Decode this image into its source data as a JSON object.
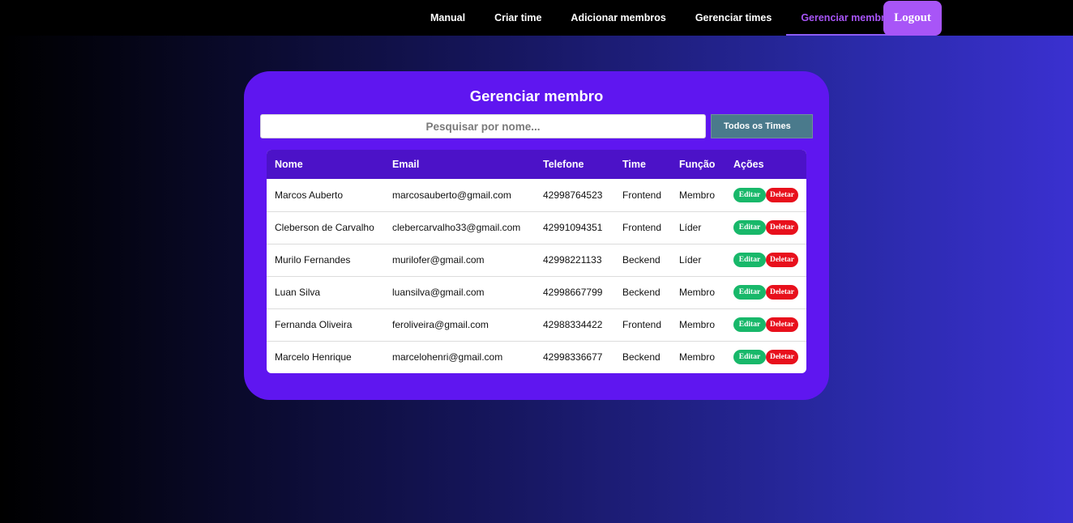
{
  "nav": {
    "items": [
      {
        "label": "Manual",
        "active": false
      },
      {
        "label": "Criar time",
        "active": false
      },
      {
        "label": "Adicionar membros",
        "active": false
      },
      {
        "label": "Gerenciar times",
        "active": false
      },
      {
        "label": "Gerenciar membros",
        "active": true
      }
    ],
    "logout_label": "Logout"
  },
  "card": {
    "title": "Gerenciar membro",
    "search_placeholder": "Pesquisar por nome...",
    "team_filter": "Todos os Times"
  },
  "table": {
    "columns": [
      "Nome",
      "Email",
      "Telefone",
      "Time",
      "Função",
      "Ações"
    ],
    "edit_label": "Editar",
    "delete_label": "Deletar",
    "rows": [
      {
        "nome": "Marcos Auberto",
        "email": "marcosauberto@gmail.com",
        "telefone": "42998764523",
        "time": "Frontend",
        "funcao": "Membro"
      },
      {
        "nome": "Cleberson de Carvalho",
        "email": "clebercarvalho33@gmail.com",
        "telefone": "42991094351",
        "time": "Frontend",
        "funcao": "Líder"
      },
      {
        "nome": "Murilo Fernandes",
        "email": "murilofer@gmail.com",
        "telefone": "42998221133",
        "time": "Beckend",
        "funcao": "Líder"
      },
      {
        "nome": "Luan Silva",
        "email": "luansilva@gmail.com",
        "telefone": "42998667799",
        "time": "Beckend",
        "funcao": "Membro"
      },
      {
        "nome": "Fernanda Oliveira",
        "email": "feroliveira@gmail.com",
        "telefone": "42988334422",
        "time": "Frontend",
        "funcao": "Membro"
      },
      {
        "nome": "Marcelo Henrique",
        "email": "marcelohenri@gmail.com",
        "telefone": "42998336677",
        "time": "Beckend",
        "funcao": "Membro"
      }
    ]
  },
  "colors": {
    "accent": "#a855f7",
    "card": "#5f16f0",
    "table_header": "#4c12c8",
    "edit": "#18b86a",
    "delete": "#e8101c"
  }
}
